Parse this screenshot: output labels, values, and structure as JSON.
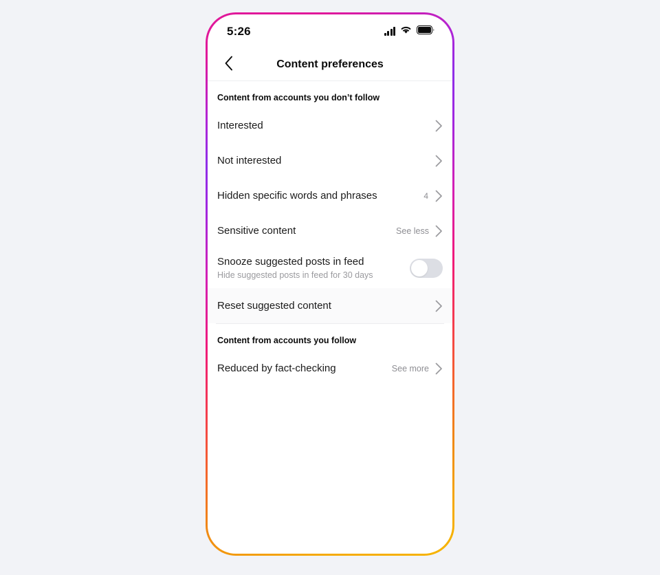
{
  "theme": {
    "page_background": "#f2f3f7",
    "screen_background": "#ffffff",
    "primary_text": "#1a1a1a",
    "secondary_text": "#8e8e93",
    "divider": "#ececee",
    "toggle_off_track": "#dcdee4",
    "frame_gradient_stops": [
      "#e0189a",
      "#8f2ee8",
      "#d41fb4",
      "#f0197a",
      "#f4622e",
      "#f7b500"
    ]
  },
  "status_bar": {
    "time": "5:26",
    "signal_icon": "signal-bars-icon",
    "wifi_icon": "wifi-icon",
    "battery_icon": "battery-full-icon"
  },
  "nav": {
    "back_icon": "chevron-left-icon",
    "title": "Content preferences"
  },
  "sections": [
    {
      "header": "Content from accounts you don’t follow",
      "rows": [
        {
          "label": "Interested",
          "value": "",
          "count": "",
          "type": "link",
          "shaded": false
        },
        {
          "label": "Not interested",
          "value": "",
          "count": "",
          "type": "link",
          "shaded": false
        },
        {
          "label": "Hidden specific words and phrases",
          "value": "",
          "count": "4",
          "type": "link",
          "shaded": false
        },
        {
          "label": "Sensitive content",
          "value": "See less",
          "count": "",
          "type": "link",
          "shaded": false
        },
        {
          "label": "Snooze suggested posts in feed",
          "sublabel": "Hide suggested posts in feed for 30 days",
          "type": "toggle",
          "toggle_on": false,
          "shaded": false
        },
        {
          "label": "Reset suggested content",
          "value": "",
          "count": "",
          "type": "link",
          "shaded": true
        }
      ]
    },
    {
      "header": "Content from accounts you follow",
      "rows": [
        {
          "label": "Reduced by fact-checking",
          "value": "See more",
          "count": "",
          "type": "link",
          "shaded": false
        }
      ]
    }
  ]
}
